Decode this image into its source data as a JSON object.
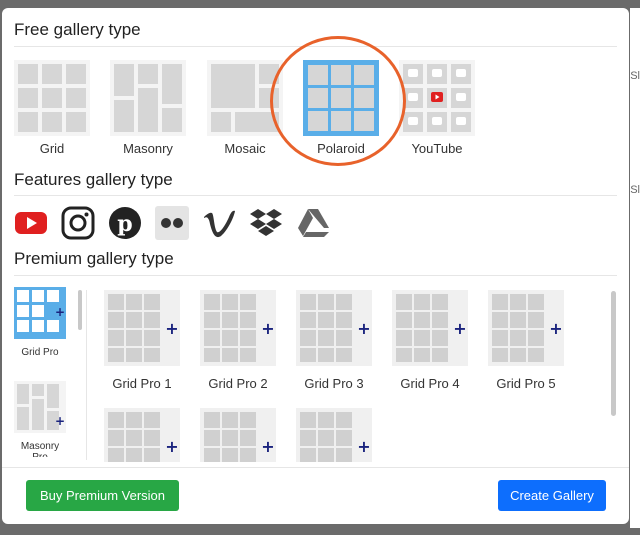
{
  "background": {
    "side_text": [
      "Sl",
      "Sl"
    ]
  },
  "free": {
    "title": "Free gallery type",
    "items": [
      {
        "label": "Grid",
        "icon": "grid-thumb-icon"
      },
      {
        "label": "Masonry",
        "icon": "masonry-thumb-icon"
      },
      {
        "label": "Mosaic",
        "icon": "mosaic-thumb-icon"
      },
      {
        "label": "Polaroid",
        "icon": "polaroid-thumb-icon",
        "selected": true
      },
      {
        "label": "YouTube",
        "icon": "youtube-thumb-icon"
      }
    ]
  },
  "features": {
    "title": "Features gallery type",
    "icons": [
      "youtube-icon",
      "instagram-icon",
      "pinterest-icon",
      "flickr-icon",
      "vimeo-icon",
      "dropbox-icon",
      "google-drive-icon"
    ]
  },
  "premium": {
    "title": "Premium gallery type",
    "left_items": [
      {
        "label": "Grid Pro",
        "selected": true
      },
      {
        "label": "Masonry Pro"
      }
    ],
    "items": [
      "Grid Pro 1",
      "Grid Pro 2",
      "Grid Pro 3",
      "Grid Pro 4",
      "Grid Pro 5",
      "",
      "",
      ""
    ]
  },
  "footer": {
    "buy_label": "Buy Premium Version",
    "create_label": "Create Gallery"
  },
  "colors": {
    "accent_blue": "#5aaee8",
    "highlight": "#e8622b",
    "buy_green": "#28a745",
    "create_blue": "#0d6efd",
    "plus_navy": "#1a237e",
    "youtube_red": "#e02020"
  }
}
